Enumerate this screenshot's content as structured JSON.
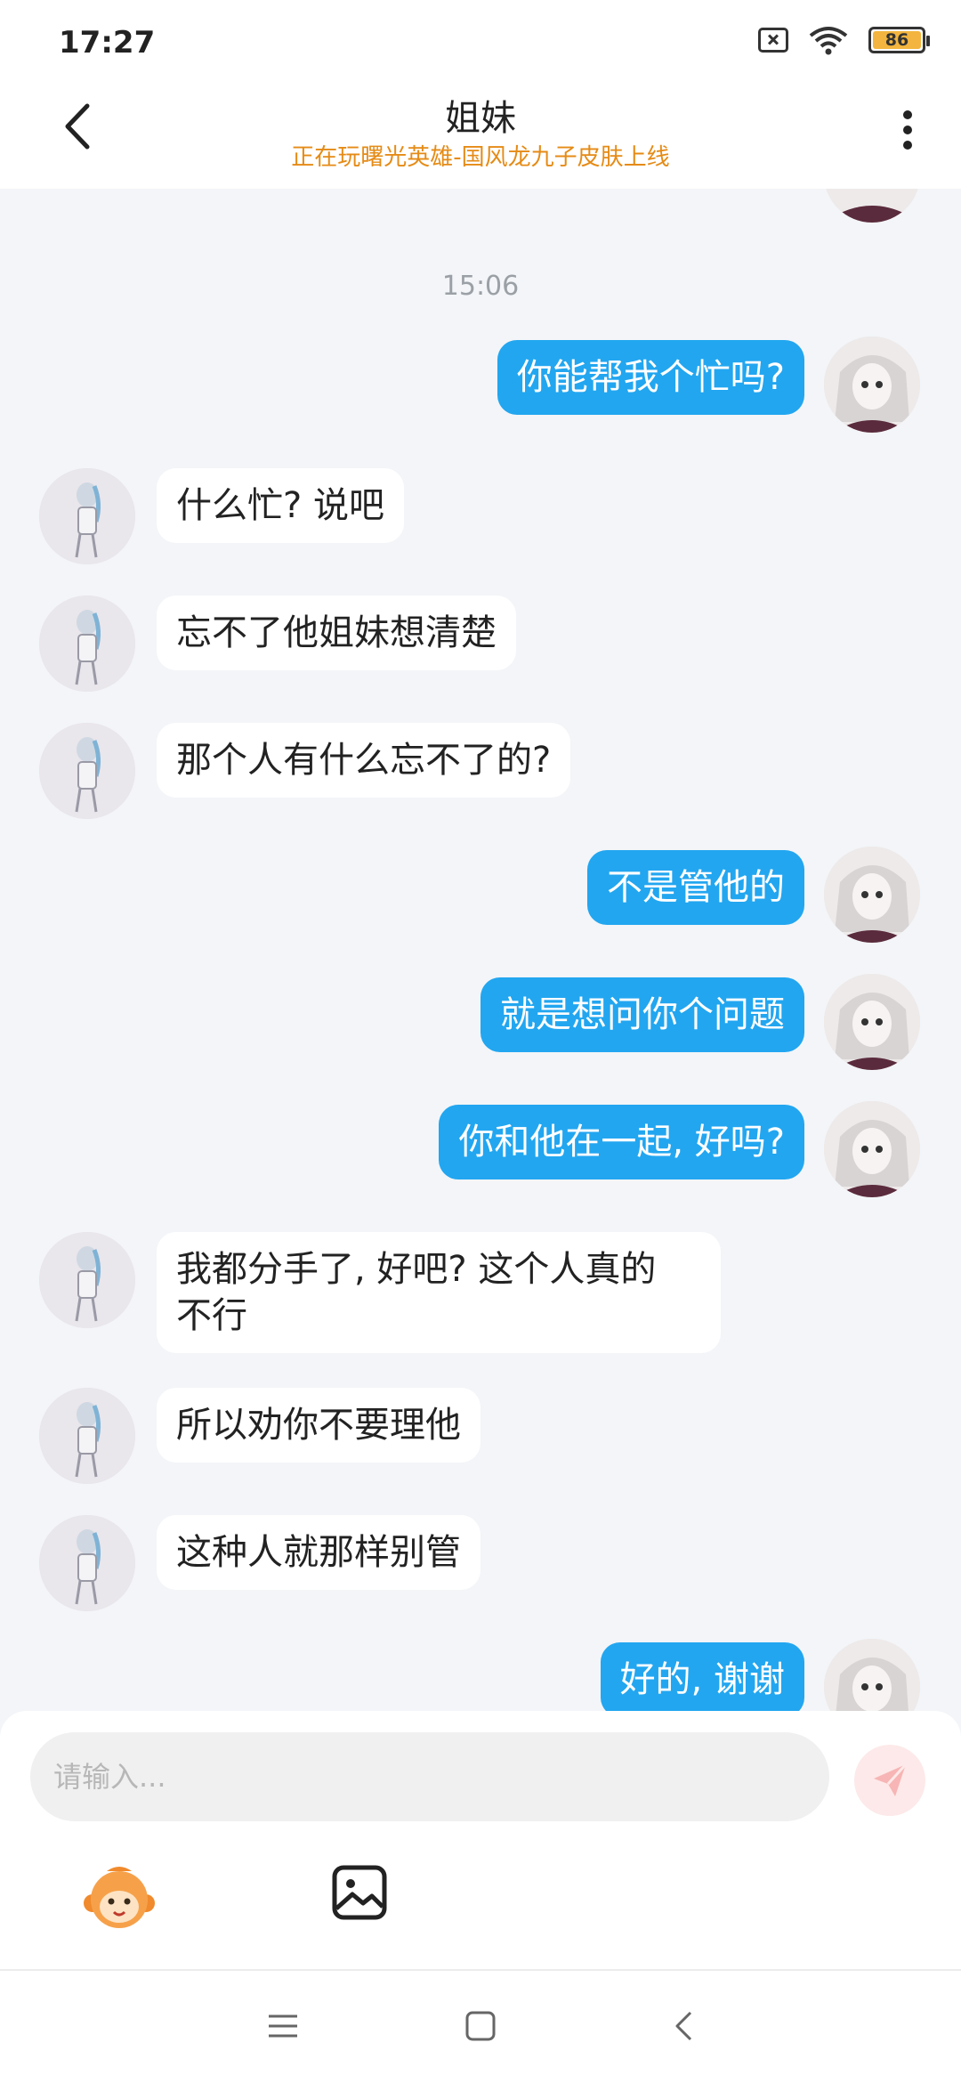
{
  "status_bar": {
    "time": "17:27",
    "battery": "86"
  },
  "header": {
    "title": "姐妹",
    "subtitle": "正在玩曙光英雄-国风龙九子皮肤上线"
  },
  "chat": {
    "timestamp": "15:06",
    "messages": [
      {
        "side": "right",
        "text": "你能帮我个忙吗?"
      },
      {
        "side": "left",
        "text": "什么忙? 说吧"
      },
      {
        "side": "left",
        "text": "忘不了他姐妹想清楚"
      },
      {
        "side": "left",
        "text": "那个人有什么忘不了的?"
      },
      {
        "side": "right",
        "text": "不是管他的"
      },
      {
        "side": "right",
        "text": "就是想问你个问题"
      },
      {
        "side": "right",
        "text": "你和他在一起, 好吗?"
      },
      {
        "side": "left",
        "text": "我都分手了, 好吧? 这个人真的",
        "text2": "不行"
      },
      {
        "side": "left",
        "text": "所以劝你不要理他"
      },
      {
        "side": "left",
        "text": "这种人就那样别管"
      },
      {
        "side": "right",
        "text": "好的, 谢谢"
      }
    ]
  },
  "input": {
    "placeholder": "请输入..."
  },
  "colors": {
    "accent": "#22a6f0",
    "subtitle": "#e58b16",
    "background": "#f3f5f8"
  }
}
